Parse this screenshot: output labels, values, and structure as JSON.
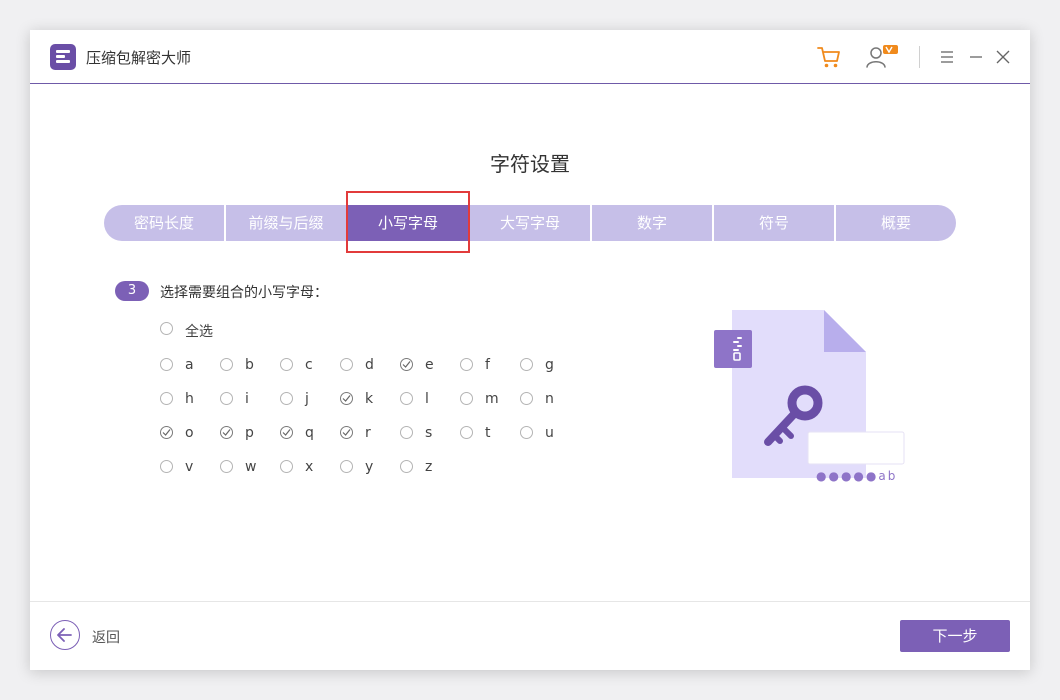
{
  "app": {
    "title": "压缩包解密大师"
  },
  "titlebar_icons": [
    "app-logo-icon",
    "cart-icon",
    "user-vip-icon",
    "menu-icon",
    "minimize-icon",
    "close-icon"
  ],
  "page": {
    "heading": "字符设置"
  },
  "steps": [
    {
      "label": "密码长度",
      "active": false
    },
    {
      "label": "前缀与后缀",
      "active": false
    },
    {
      "label": "小写字母",
      "active": true
    },
    {
      "label": "大写字母",
      "active": false
    },
    {
      "label": "数字",
      "active": false
    },
    {
      "label": "符号",
      "active": false
    },
    {
      "label": "概要",
      "active": false
    }
  ],
  "question": {
    "number": "3",
    "text": "选择需要组合的小写字母："
  },
  "select_all": {
    "label": "全选",
    "checked": false
  },
  "letters": [
    {
      "label": "a",
      "checked": false
    },
    {
      "label": "b",
      "checked": false
    },
    {
      "label": "c",
      "checked": false
    },
    {
      "label": "d",
      "checked": false
    },
    {
      "label": "e",
      "checked": true
    },
    {
      "label": "f",
      "checked": false
    },
    {
      "label": "g",
      "checked": false
    },
    {
      "label": "h",
      "checked": false
    },
    {
      "label": "i",
      "checked": false
    },
    {
      "label": "j",
      "checked": false
    },
    {
      "label": "k",
      "checked": true
    },
    {
      "label": "l",
      "checked": false
    },
    {
      "label": "m",
      "checked": false
    },
    {
      "label": "n",
      "checked": false
    },
    {
      "label": "o",
      "checked": true
    },
    {
      "label": "p",
      "checked": true
    },
    {
      "label": "q",
      "checked": true
    },
    {
      "label": "r",
      "checked": true
    },
    {
      "label": "s",
      "checked": false
    },
    {
      "label": "t",
      "checked": false
    },
    {
      "label": "u",
      "checked": false
    },
    {
      "label": "v",
      "checked": false
    },
    {
      "label": "w",
      "checked": false
    },
    {
      "label": "x",
      "checked": false
    },
    {
      "label": "y",
      "checked": false
    },
    {
      "label": "z",
      "checked": false
    }
  ],
  "illustration": {
    "password_hint": "●●●●●ab",
    "icons": [
      "zip-file-icon",
      "key-icon"
    ]
  },
  "footer": {
    "back_label": "返回",
    "next_label": "下一步"
  },
  "colors": {
    "accent": "#7c60b6",
    "step_inactive": "#c6bfe8",
    "highlight": "#e23b3b",
    "cart": "#f08a1c"
  }
}
